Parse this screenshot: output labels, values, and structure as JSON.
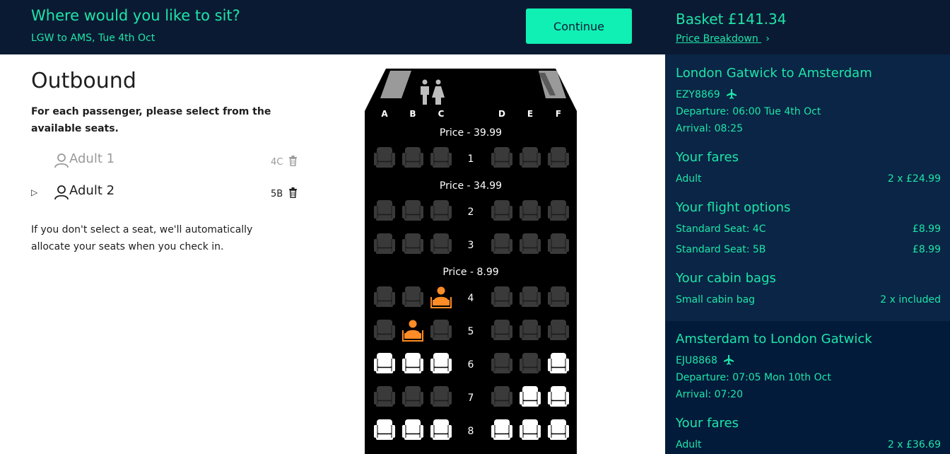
{
  "header": {
    "title": "Where would you like to sit?",
    "subtitle": "LGW to AMS, Tue 4th Oct",
    "continue_label": "Continue"
  },
  "left": {
    "heading": "Outbound",
    "instructions": "For each passenger, please select from the available seats.",
    "passengers": [
      {
        "name": "Adult 1",
        "seat": "4C",
        "active": false
      },
      {
        "name": "Adult 2",
        "seat": "5B",
        "active": true
      }
    ],
    "active_marker": "▷",
    "note": "If you don't select a seat, we'll automatically allocate your seats when you check in."
  },
  "seatmap": {
    "columns": [
      "A",
      "B",
      "C",
      "D",
      "E",
      "F"
    ],
    "price_bands": [
      "Price - 39.99",
      "Price - 34.99",
      "Price - 8.99"
    ],
    "rows": [
      {
        "num": "1",
        "seats": [
          "taken",
          "taken",
          "taken",
          "taken",
          "taken",
          "taken"
        ]
      },
      {
        "num": "2",
        "seats": [
          "taken",
          "taken",
          "taken",
          "taken",
          "taken",
          "taken"
        ]
      },
      {
        "num": "3",
        "seats": [
          "taken",
          "taken",
          "taken",
          "taken",
          "taken",
          "taken"
        ]
      },
      {
        "num": "4",
        "seats": [
          "taken",
          "taken",
          "selected",
          "taken",
          "taken",
          "taken"
        ]
      },
      {
        "num": "5",
        "seats": [
          "taken",
          "selected",
          "taken",
          "taken",
          "taken",
          "taken"
        ]
      },
      {
        "num": "6",
        "seats": [
          "available",
          "available",
          "available",
          "taken",
          "taken",
          "available"
        ]
      },
      {
        "num": "7",
        "seats": [
          "taken",
          "taken",
          "taken",
          "taken",
          "available",
          "available"
        ]
      },
      {
        "num": "8",
        "seats": [
          "available",
          "available",
          "available",
          "available",
          "available",
          "available"
        ]
      }
    ],
    "colors": {
      "taken": "#3a3a3a",
      "available": "#ffffff",
      "selected": "#ff8c26"
    }
  },
  "basket": {
    "title": "Basket £141.34",
    "breakdown_label": "Price Breakdown",
    "breakdown_chevron": "›",
    "outbound": {
      "route": "London Gatwick to Amsterdam",
      "flight": "EZY8869",
      "departure": "Departure: 06:00 Tue 4th Oct",
      "arrival": "Arrival: 08:25",
      "fares_heading": "Your fares",
      "fare_label": "Adult",
      "fare_value": "2 x £24.99",
      "options_heading": "Your flight options",
      "options": [
        {
          "label": "Standard Seat: 4C",
          "value": "£8.99"
        },
        {
          "label": "Standard Seat: 5B",
          "value": "£8.99"
        }
      ],
      "bags_heading": "Your cabin bags",
      "bag_label": "Small cabin bag",
      "bag_value": "2 x included"
    },
    "inbound": {
      "route": "Amsterdam to London Gatwick",
      "flight": "EJU8868",
      "departure": "Departure: 07:05 Mon 10th Oct",
      "arrival": "Arrival: 07:20",
      "fares_heading": "Your fares",
      "fare_label": "Adult",
      "fare_value": "2 x £36.69"
    }
  }
}
